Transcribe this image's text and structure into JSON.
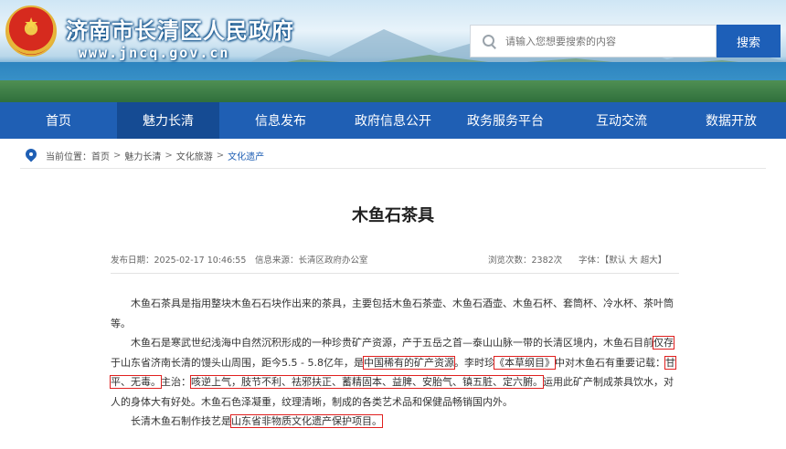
{
  "header": {
    "site_title": "济南市长清区人民政府",
    "site_url": "www.jncq.gov.cn",
    "search_placeholder": "请输入您想要搜索的内容",
    "search_button": "搜索"
  },
  "nav": {
    "items": [
      {
        "label": "首页",
        "active": false
      },
      {
        "label": "魅力长清",
        "active": true
      },
      {
        "label": "信息发布",
        "active": false
      },
      {
        "label": "政府信息公开",
        "active": false
      },
      {
        "label": "政务服务平台",
        "active": false
      },
      {
        "label": "互动交流",
        "active": false
      },
      {
        "label": "数据开放",
        "active": false
      }
    ]
  },
  "breadcrumb": {
    "prefix": "当前位置：",
    "items": [
      "首页",
      "魅力长清",
      "文化旅游",
      "文化遗产"
    ],
    "separator": ">"
  },
  "article": {
    "title": "木鱼石茶具",
    "publish_date": "发布日期：2025-02-17 10:46:55",
    "source": "信息来源：长清区政府办公室",
    "views": "浏览次数：2382次",
    "font_size_label": "字体：【默认  大  超大】",
    "paragraphs": {
      "p1": "木鱼石茶具是指用整块木鱼石石块作出来的茶具，主要包括木鱼石茶壶、木鱼石酒壶、木鱼石杯、套筒杯、冷水杯、茶叶筒等。",
      "p2_a": "木鱼石是寒武世纪浅海中自然沉积形成的一种珍贵矿产资源，产于五岳之首—泰山山脉一带的长清区境内，木鱼石目前",
      "p2_b": "仅存",
      "p2_c": "于山东省济南长清的馒头山周围，距今5.5 - 5.8亿年，是",
      "p2_d": "中国稀有的矿产资源",
      "p2_e": "。李时珍",
      "p2_f": "《本草纲目》",
      "p2_g": "中对木鱼石有重要记载：",
      "p2_h": "甘平、无毒。",
      "p2_i": "主治：",
      "p2_j": "咳逆上气，肢节不利、祛邪扶正、蓄精固本、益脾、安胎气、镇五脏、定六腑。",
      "p2_k": "运用此矿产制成茶具饮水，对人的身体大有好处。木鱼石色泽凝重，纹理清晰，制成的各类艺术品和保健品畅销国内外。",
      "p3_a": "长清木鱼石制作技艺是",
      "p3_b": "山东省非物质文化遗产保护项目。"
    }
  },
  "colors": {
    "nav_bg": "#1f5fb4",
    "nav_active": "#154b93",
    "search_button": "#1d5fb8",
    "highlight_box": "#e0201f"
  }
}
